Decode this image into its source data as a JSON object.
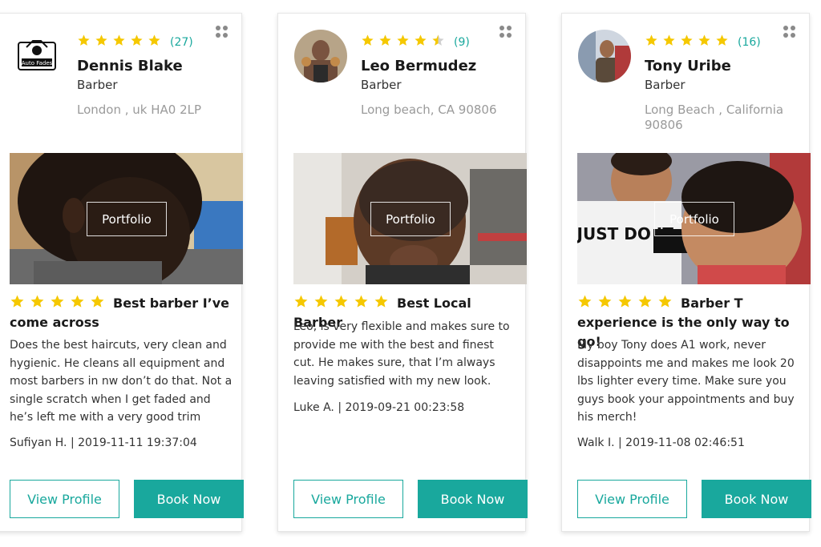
{
  "colors": {
    "accent": "#19a89d",
    "star": "#f5c800",
    "star_empty": "#cfcfcf"
  },
  "cards": [
    {
      "rating_count": "(27)",
      "rating": 5,
      "name": "Dennis Blake",
      "role": "Barber",
      "location": "London , uk HA0 2LP",
      "avatar_text": "Auto Fades",
      "portfolio_label": "Portfolio",
      "review_rating": 5,
      "review_title": "Best barber I’ve come across",
      "review_text": "Does the best haircuts, very clean and hygienic. He cleans all equipment and most barbers in nw don’t do that. Not a single scratch when I get faded and he’s left me with a very good trim",
      "reviewer": "Sufiyan H. | 2019-11-11 19:37:04",
      "view_label": "View Profile",
      "book_label": "Book Now"
    },
    {
      "rating_count": "(9)",
      "rating": 4.5,
      "name": "Leo Bermudez",
      "role": "Barber",
      "location": "Long beach, CA 90806",
      "portfolio_label": "Portfolio",
      "review_rating": 5,
      "review_title": "Best Local Barber",
      "review_text": "Leo, is very flexible and makes sure to provide me with the best and finest cut. He makes sure, that I’m always leaving satisfied with my new look.",
      "reviewer": "Luke A. | 2019-09-21 00:23:58",
      "view_label": "View Profile",
      "book_label": "Book Now"
    },
    {
      "rating_count": "(16)",
      "rating": 5,
      "name": "Tony Uribe",
      "role": "Barber",
      "location": "Long Beach , California 90806",
      "portfolio_label": "Portfolio",
      "photo_shirt_text": "JUST DO IT.",
      "review_rating": 5,
      "review_title": "Barber T experience is the only way to go!",
      "review_text": "My boy Tony does A1 work, never disappoints me and makes me look 20 lbs lighter every time. Make sure you guys book your appointments and buy his merch!",
      "reviewer": "Walk I. | 2019-11-08 02:46:51",
      "view_label": "View Profile",
      "book_label": "Book Now"
    }
  ]
}
